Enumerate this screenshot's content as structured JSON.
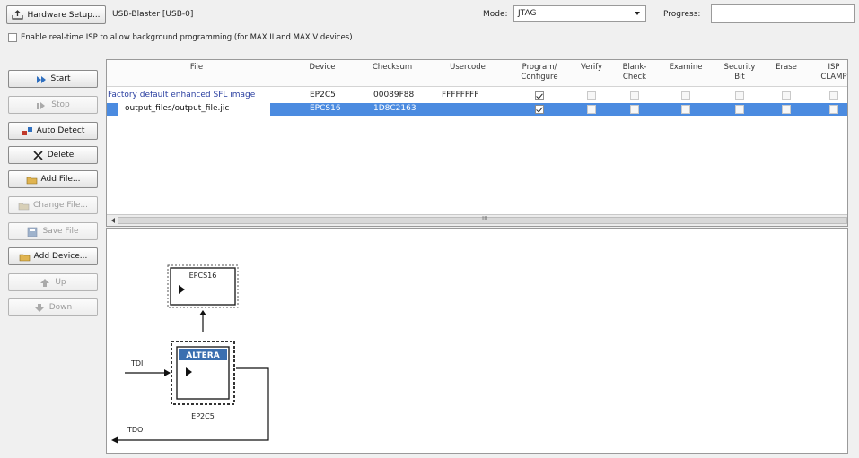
{
  "toolbar": {
    "hardware_setup_label": "Hardware Setup...",
    "hardware_value": "USB-Blaster [USB-0]",
    "mode_label": "Mode:",
    "mode_value": "JTAG",
    "progress_label": "Progress:",
    "realtime_isp_label": "Enable real-time ISP to allow background programming (for MAX II and MAX V devices)",
    "realtime_isp_checked": false
  },
  "side_buttons": [
    {
      "label": "Start",
      "icon": "start-icon",
      "enabled": true
    },
    {
      "label": "Stop",
      "icon": "stop-icon",
      "enabled": false
    },
    {
      "label": "Auto Detect",
      "icon": "auto-detect-icon",
      "enabled": true
    },
    {
      "label": "Delete",
      "icon": "delete-icon",
      "enabled": true
    },
    {
      "label": "Add File...",
      "icon": "add-file-icon",
      "enabled": true
    },
    {
      "label": "Change File...",
      "icon": "change-file-icon",
      "enabled": false
    },
    {
      "label": "Save File",
      "icon": "save-file-icon",
      "enabled": false
    },
    {
      "label": "Add Device...",
      "icon": "add-device-icon",
      "enabled": true
    },
    {
      "label": "Up",
      "icon": "up-arrow-icon",
      "enabled": false
    },
    {
      "label": "Down",
      "icon": "down-arrow-icon",
      "enabled": false
    }
  ],
  "table": {
    "columns": [
      "File",
      "Device",
      "Checksum",
      "Usercode",
      "Program/\nConfigure",
      "Verify",
      "Blank-\nCheck",
      "Examine",
      "Security\nBit",
      "Erase",
      "ISP\nCLAMP"
    ],
    "rows": [
      {
        "file": "Factory default enhanced SFL image",
        "device": "EP2C5",
        "checksum": "00089F88",
        "usercode": "FFFFFFFF",
        "checks": [
          true,
          false,
          false,
          false,
          false,
          false,
          false
        ],
        "selected": false
      },
      {
        "file": "output_files/output_file.jic",
        "device": "EPCS16",
        "checksum": "1D8C2163",
        "usercode": "",
        "checks": [
          true,
          false,
          false,
          false,
          false,
          false,
          false
        ],
        "selected": true
      }
    ],
    "scroll_marker": "III"
  },
  "chain": {
    "flash_device": "EPCS16",
    "fpga_device": "EP2C5",
    "fpga_logo": "ALTERA",
    "tdi_label": "TDI",
    "tdo_label": "TDO"
  },
  "colors": {
    "selection": "#4b8be0",
    "file_link": "#2a3fa0",
    "fpga_logo_bg": "#3a6fb0"
  }
}
